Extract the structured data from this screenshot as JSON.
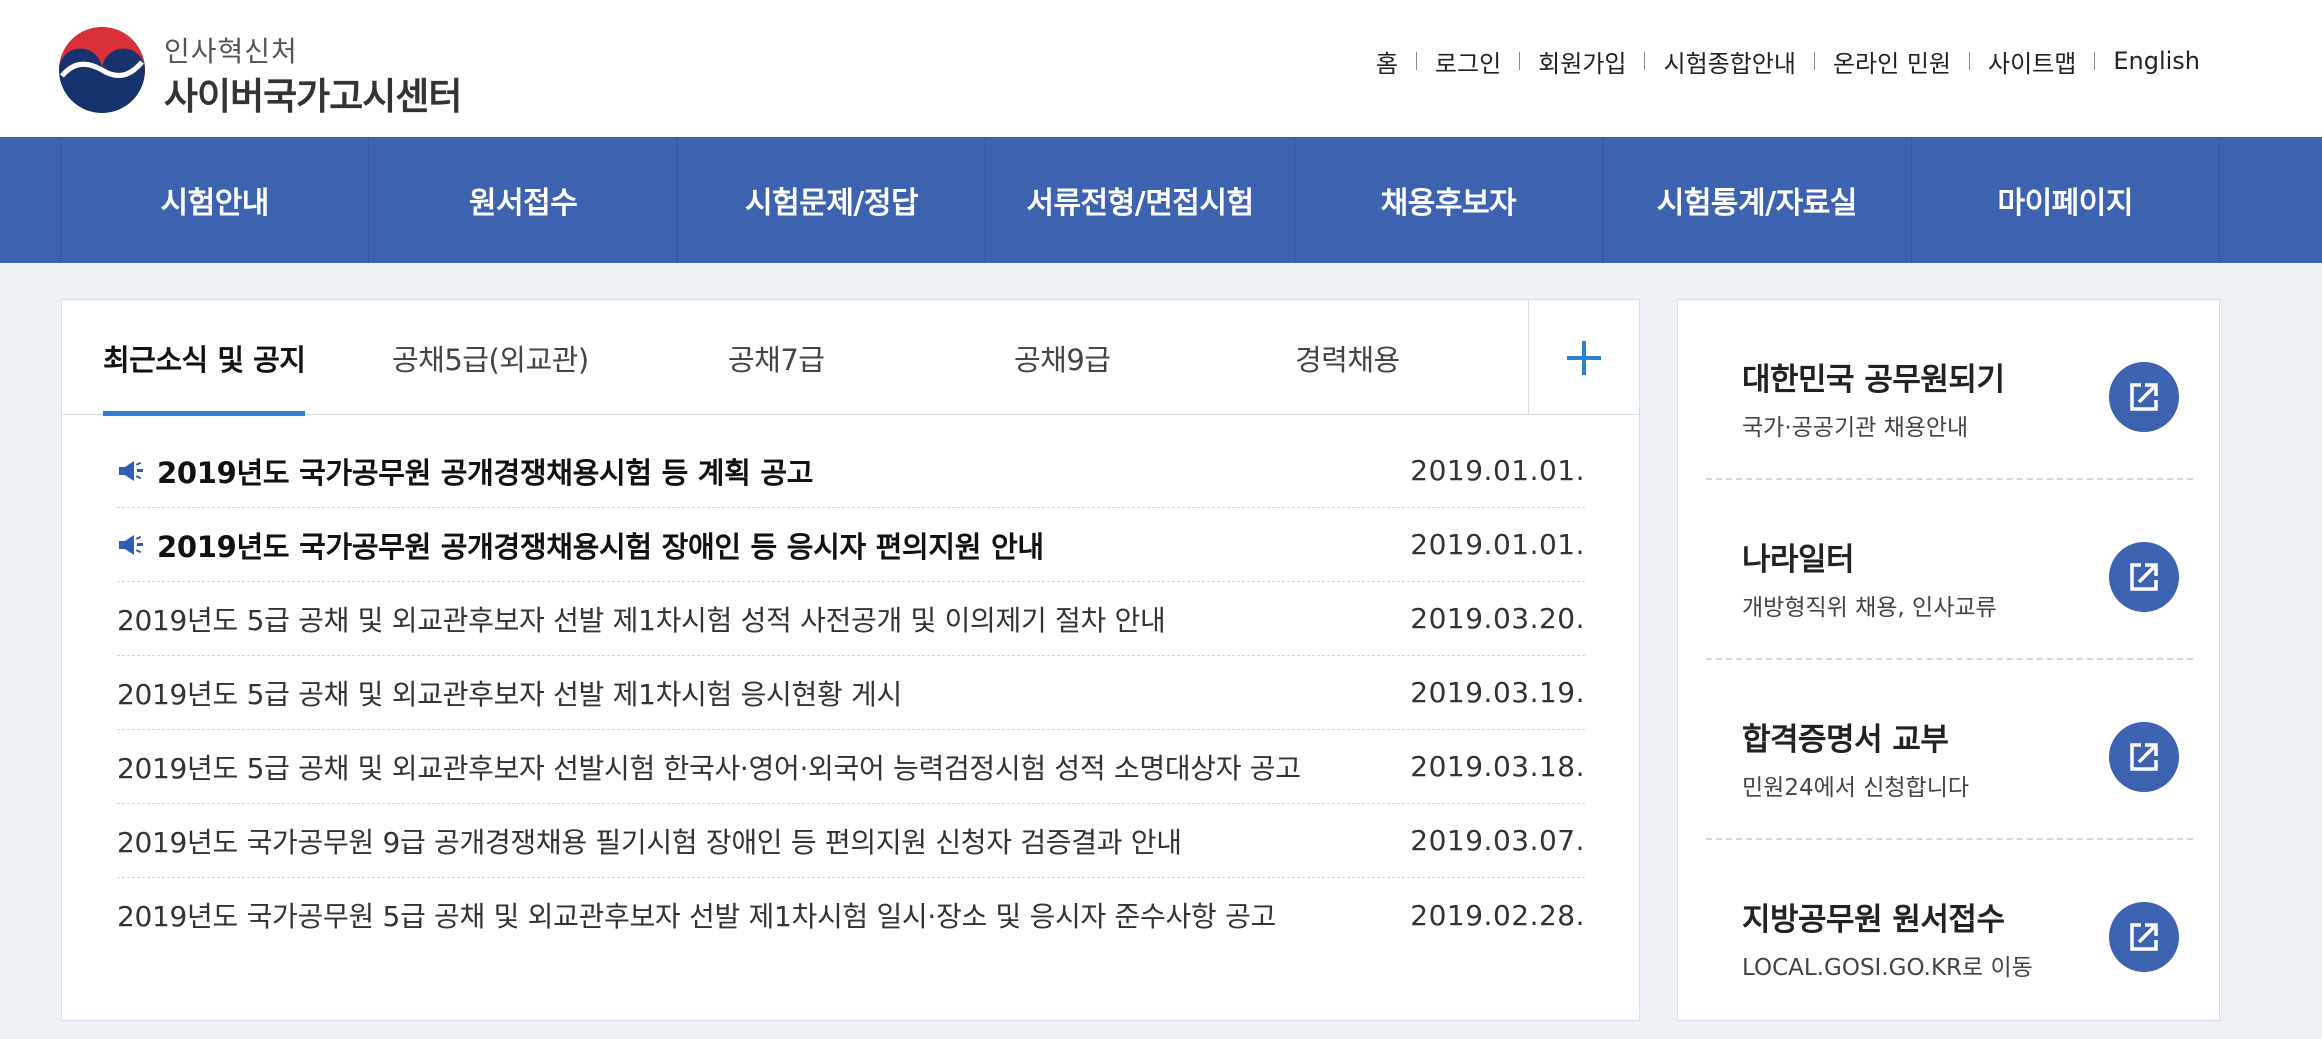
{
  "header": {
    "org_name": "인사혁신처",
    "site_name": "사이버국가고시센터",
    "utility_links": [
      "홈",
      "로그인",
      "회원가입",
      "시험종합안내",
      "온라인 민원",
      "사이트맵",
      "English"
    ]
  },
  "gnb": {
    "items": [
      "시험안내",
      "원서접수",
      "시험문제/정답",
      "서류전형/면접시험",
      "채용후보자",
      "시험통계/자료실",
      "마이페이지"
    ]
  },
  "notice": {
    "tabs": [
      "최근소식 및 공지",
      "공채5급(외교관)",
      "공채7급",
      "공채9급",
      "경력채용"
    ],
    "active_tab": 0,
    "more_icon": "plus-icon",
    "items": [
      {
        "title": "2019년도 국가공무원 공개경쟁채용시험 등 계획 공고",
        "date": "2019.01.01.",
        "pinned": true
      },
      {
        "title": "2019년도 국가공무원 공개경쟁채용시험 장애인 등 응시자 편의지원 안내",
        "date": "2019.01.01.",
        "pinned": true
      },
      {
        "title": "2019년도 5급 공채 및 외교관후보자 선발 제1차시험 성적 사전공개 및 이의제기 절차 안내",
        "date": "2019.03.20.",
        "pinned": false
      },
      {
        "title": "2019년도 5급 공채 및 외교관후보자 선발 제1차시험 응시현황 게시",
        "date": "2019.03.19.",
        "pinned": false
      },
      {
        "title": "2019년도 5급 공채 및 외교관후보자 선발시험 한국사·영어·외국어 능력검정시험 성적 소명대상자 공고",
        "date": "2019.03.18.",
        "pinned": false
      },
      {
        "title": "2019년도 국가공무원 9급 공개경쟁채용 필기시험 장애인 등 편의지원 신청자 검증결과 안내",
        "date": "2019.03.07.",
        "pinned": false
      },
      {
        "title": "2019년도 국가공무원 5급 공채 및 외교관후보자 선발 제1차시험 일시·장소 및 응시자 준수사항 공고",
        "date": "2019.02.28.",
        "pinned": false
      }
    ]
  },
  "services": [
    {
      "title": "대한민국 공무원되기",
      "subtitle": "국가·공공기관 채용안내"
    },
    {
      "title": "나라일터",
      "subtitle": "개방형직위 채용, 인사교류"
    },
    {
      "title": "합격증명서 교부",
      "subtitle": "민원24에서 신청합니다"
    },
    {
      "title": "지방공무원 원서접수",
      "subtitle": "LOCAL.GOSI.GO.KR로 이동"
    }
  ],
  "colors": {
    "nav_blue": "#3d63b0",
    "tab_underline": "#2b7fd4",
    "page_bg": "#eef2f7"
  }
}
